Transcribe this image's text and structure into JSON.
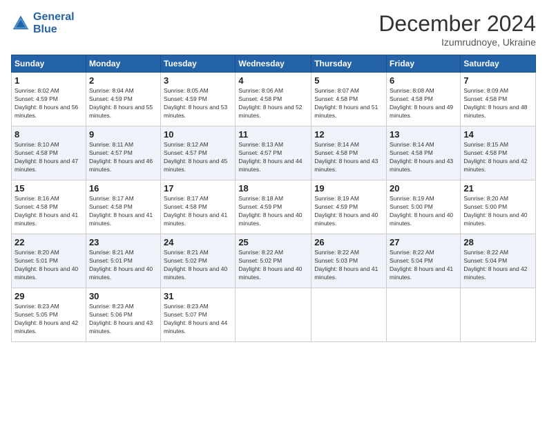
{
  "header": {
    "logo_line1": "General",
    "logo_line2": "Blue",
    "month_title": "December 2024",
    "location": "Izumrudnoye, Ukraine"
  },
  "weekdays": [
    "Sunday",
    "Monday",
    "Tuesday",
    "Wednesday",
    "Thursday",
    "Friday",
    "Saturday"
  ],
  "weeks": [
    [
      {
        "day": "1",
        "sunrise": "8:02 AM",
        "sunset": "4:59 PM",
        "daylight": "8 hours and 56 minutes."
      },
      {
        "day": "2",
        "sunrise": "8:04 AM",
        "sunset": "4:59 PM",
        "daylight": "8 hours and 55 minutes."
      },
      {
        "day": "3",
        "sunrise": "8:05 AM",
        "sunset": "4:59 PM",
        "daylight": "8 hours and 53 minutes."
      },
      {
        "day": "4",
        "sunrise": "8:06 AM",
        "sunset": "4:58 PM",
        "daylight": "8 hours and 52 minutes."
      },
      {
        "day": "5",
        "sunrise": "8:07 AM",
        "sunset": "4:58 PM",
        "daylight": "8 hours and 51 minutes."
      },
      {
        "day": "6",
        "sunrise": "8:08 AM",
        "sunset": "4:58 PM",
        "daylight": "8 hours and 49 minutes."
      },
      {
        "day": "7",
        "sunrise": "8:09 AM",
        "sunset": "4:58 PM",
        "daylight": "8 hours and 48 minutes."
      }
    ],
    [
      {
        "day": "8",
        "sunrise": "8:10 AM",
        "sunset": "4:58 PM",
        "daylight": "8 hours and 47 minutes."
      },
      {
        "day": "9",
        "sunrise": "8:11 AM",
        "sunset": "4:57 PM",
        "daylight": "8 hours and 46 minutes."
      },
      {
        "day": "10",
        "sunrise": "8:12 AM",
        "sunset": "4:57 PM",
        "daylight": "8 hours and 45 minutes."
      },
      {
        "day": "11",
        "sunrise": "8:13 AM",
        "sunset": "4:57 PM",
        "daylight": "8 hours and 44 minutes."
      },
      {
        "day": "12",
        "sunrise": "8:14 AM",
        "sunset": "4:58 PM",
        "daylight": "8 hours and 43 minutes."
      },
      {
        "day": "13",
        "sunrise": "8:14 AM",
        "sunset": "4:58 PM",
        "daylight": "8 hours and 43 minutes."
      },
      {
        "day": "14",
        "sunrise": "8:15 AM",
        "sunset": "4:58 PM",
        "daylight": "8 hours and 42 minutes."
      }
    ],
    [
      {
        "day": "15",
        "sunrise": "8:16 AM",
        "sunset": "4:58 PM",
        "daylight": "8 hours and 41 minutes."
      },
      {
        "day": "16",
        "sunrise": "8:17 AM",
        "sunset": "4:58 PM",
        "daylight": "8 hours and 41 minutes."
      },
      {
        "day": "17",
        "sunrise": "8:17 AM",
        "sunset": "4:58 PM",
        "daylight": "8 hours and 41 minutes."
      },
      {
        "day": "18",
        "sunrise": "8:18 AM",
        "sunset": "4:59 PM",
        "daylight": "8 hours and 40 minutes."
      },
      {
        "day": "19",
        "sunrise": "8:19 AM",
        "sunset": "4:59 PM",
        "daylight": "8 hours and 40 minutes."
      },
      {
        "day": "20",
        "sunrise": "8:19 AM",
        "sunset": "5:00 PM",
        "daylight": "8 hours and 40 minutes."
      },
      {
        "day": "21",
        "sunrise": "8:20 AM",
        "sunset": "5:00 PM",
        "daylight": "8 hours and 40 minutes."
      }
    ],
    [
      {
        "day": "22",
        "sunrise": "8:20 AM",
        "sunset": "5:01 PM",
        "daylight": "8 hours and 40 minutes."
      },
      {
        "day": "23",
        "sunrise": "8:21 AM",
        "sunset": "5:01 PM",
        "daylight": "8 hours and 40 minutes."
      },
      {
        "day": "24",
        "sunrise": "8:21 AM",
        "sunset": "5:02 PM",
        "daylight": "8 hours and 40 minutes."
      },
      {
        "day": "25",
        "sunrise": "8:22 AM",
        "sunset": "5:02 PM",
        "daylight": "8 hours and 40 minutes."
      },
      {
        "day": "26",
        "sunrise": "8:22 AM",
        "sunset": "5:03 PM",
        "daylight": "8 hours and 41 minutes."
      },
      {
        "day": "27",
        "sunrise": "8:22 AM",
        "sunset": "5:04 PM",
        "daylight": "8 hours and 41 minutes."
      },
      {
        "day": "28",
        "sunrise": "8:22 AM",
        "sunset": "5:04 PM",
        "daylight": "8 hours and 42 minutes."
      }
    ],
    [
      {
        "day": "29",
        "sunrise": "8:23 AM",
        "sunset": "5:05 PM",
        "daylight": "8 hours and 42 minutes."
      },
      {
        "day": "30",
        "sunrise": "8:23 AM",
        "sunset": "5:06 PM",
        "daylight": "8 hours and 43 minutes."
      },
      {
        "day": "31",
        "sunrise": "8:23 AM",
        "sunset": "5:07 PM",
        "daylight": "8 hours and 44 minutes."
      },
      null,
      null,
      null,
      null
    ]
  ],
  "labels": {
    "sunrise": "Sunrise:",
    "sunset": "Sunset:",
    "daylight": "Daylight:"
  }
}
